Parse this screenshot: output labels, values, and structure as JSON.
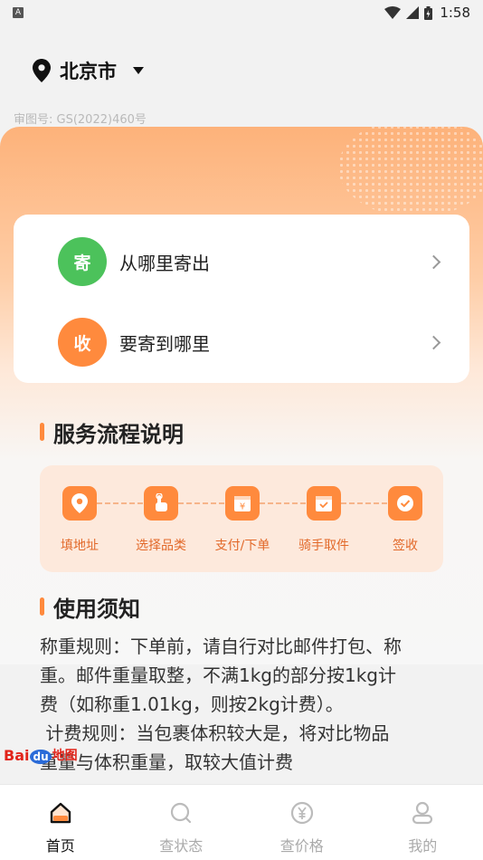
{
  "status_bar": {
    "notif_letter": "A",
    "time": "1:58"
  },
  "location": {
    "city": "北京市"
  },
  "map_approval": "审图号: GS(2022)460号",
  "address_card": {
    "from": {
      "badge": "寄",
      "label": "从哪里寄出",
      "color": "#4cc25b"
    },
    "to": {
      "badge": "收",
      "label": "要寄到哪里",
      "color": "#ff8a3d"
    }
  },
  "process": {
    "title": "服务流程说明",
    "steps": [
      "填地址",
      "选择品类",
      "支付/下单",
      "骑手取件",
      "签收"
    ]
  },
  "notice": {
    "title": "使用须知",
    "lines": [
      "称重规则：下单前，请自行对比邮件打包、称",
      "重。邮件重量取整，不满1kg的部分按1kg计",
      "费（如称重1.01kg，则按2kg计费）。",
      " 计费规则：当包裹体积较大是，将对比物品",
      "重量与体积重量，取较大值计费"
    ]
  },
  "baidu_logo": {
    "bai": "Bai",
    "du": "du",
    "map": "地图"
  },
  "tabs": [
    {
      "label": "首页",
      "icon": "home-icon",
      "active": true
    },
    {
      "label": "查状态",
      "icon": "search-icon",
      "active": false
    },
    {
      "label": "查价格",
      "icon": "yuan-icon",
      "active": false
    },
    {
      "label": "我的",
      "icon": "user-icon",
      "active": false
    }
  ],
  "colors": {
    "accent": "#ff8a3d",
    "green": "#4cc25b"
  }
}
